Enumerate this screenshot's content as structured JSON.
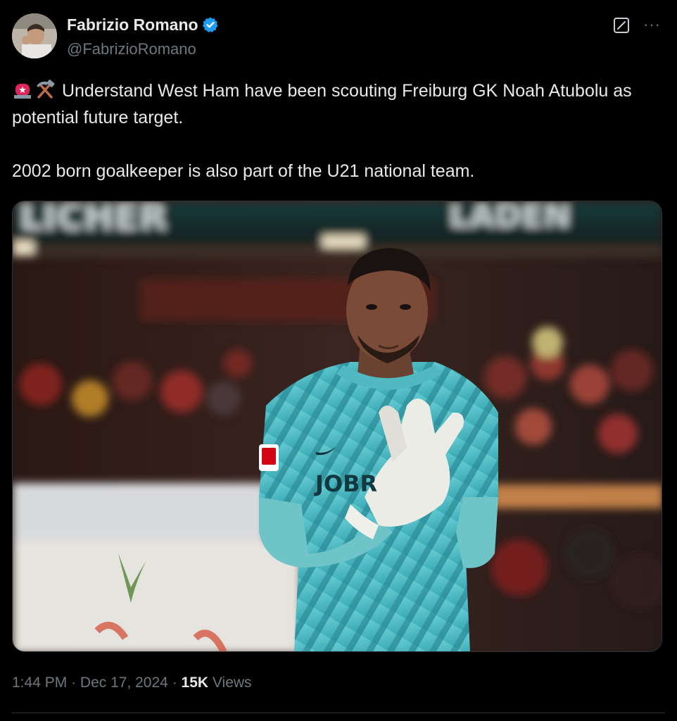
{
  "author": {
    "name": "Fabrizio Romano",
    "handle": "@FabrizioRomano",
    "verified": true,
    "verified_color": "#1d9bf0"
  },
  "actions": {
    "grok_icon": "grok-icon",
    "more_label": "···"
  },
  "tweet": {
    "emojis": [
      "police-light-emoji",
      "hammer-and-pick-emoji"
    ],
    "line1": "Understand West Ham have been scouting Freiburg GK Noah Atubolu as potential future target.",
    "line2": "2002 born goalkeeper is also part of the U21 national team."
  },
  "media": {
    "sponsor_text": "JOBR",
    "banner_text_left": "LICHER",
    "banner_text_right": "LADEN"
  },
  "meta": {
    "time": "1:44 PM",
    "separator": "·",
    "date": "Dec 17, 2024",
    "views_count": "15K",
    "views_label": "Views"
  }
}
